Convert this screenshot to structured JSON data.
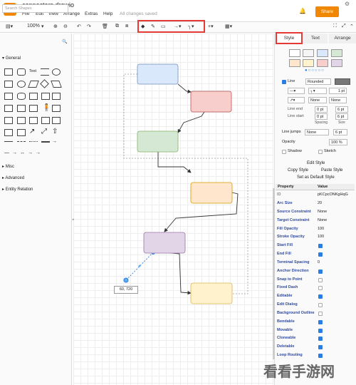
{
  "app": {
    "file_title": "connectors.drawio",
    "status": "All changes saved",
    "share_label": "Share"
  },
  "menu": [
    "File",
    "Edit",
    "View",
    "Arrange",
    "Extras",
    "Help"
  ],
  "toolbar": {
    "zoom": "100%"
  },
  "sidebar": {
    "search_placeholder": "Search Shapes",
    "sections": {
      "general": "General",
      "misc": "Misc",
      "advanced": "Advanced",
      "entity": "Entity Relation"
    }
  },
  "canvas": {
    "coord_label": "60, 720"
  },
  "panel": {
    "tabs": {
      "style": "Style",
      "text": "Text",
      "arrange": "Arrange"
    },
    "line_label": "Line",
    "line_style": "Rounded",
    "line_width": "1 pt",
    "none1": "None",
    "none2": "None",
    "line_end_label": "Line end",
    "line_start_label": "Line start",
    "end_spacing": "0 pt",
    "end_size": "6 pt",
    "start_spacing": "0 pt",
    "start_size": "6 pt",
    "spacing_label": "Spacing",
    "size_label": "Size",
    "line_jumps_label": "Line jumps",
    "line_jumps_value": "None",
    "line_jumps_size": "6 pt",
    "opacity_label": "Opacity",
    "opacity_value": "100 %",
    "shadow_label": "Shadow",
    "sketch_label": "Sketch",
    "edit_style": "Edit Style",
    "copy_style": "Copy Style",
    "paste_style": "Paste Style",
    "set_default": "Set as Default Style",
    "prop_header": "Property",
    "value_header": "Value",
    "id_label": "ID",
    "id_value": "pKCpcONKgHqG",
    "rows": [
      {
        "name": "Arc Size",
        "value": "20"
      },
      {
        "name": "Source Constraint",
        "value": "None"
      },
      {
        "name": "Target Constraint",
        "value": "None"
      },
      {
        "name": "Fill Opacity",
        "value": "100"
      },
      {
        "name": "Stroke Opacity",
        "value": "100"
      },
      {
        "name": "Start Fill",
        "value": ""
      },
      {
        "name": "End Fill",
        "value": ""
      },
      {
        "name": "Terminal Spacing",
        "value": "0"
      },
      {
        "name": "Anchor Direction",
        "value": ""
      },
      {
        "name": "Snap to Point",
        "value": ""
      },
      {
        "name": "Fixed Dash",
        "value": ""
      },
      {
        "name": "Editable",
        "value": ""
      },
      {
        "name": "Edit Dialog",
        "value": ""
      },
      {
        "name": "Background Outline",
        "value": ""
      },
      {
        "name": "Bendable",
        "value": ""
      },
      {
        "name": "Movable",
        "value": ""
      },
      {
        "name": "Cloneable",
        "value": ""
      },
      {
        "name": "Deletable",
        "value": ""
      },
      {
        "name": "Loop Routing",
        "value": ""
      }
    ]
  },
  "watermark": "看看手游网",
  "colors": {
    "accent": "#f08705",
    "highlight": "#e53935",
    "blue_fill": "#dae8fc",
    "red_fill": "#f8cecc",
    "green_fill": "#d5e8d4",
    "orange_fill": "#ffe6cc",
    "purple_fill": "#e1d5e7",
    "yellow_fill": "#fff2cc"
  }
}
